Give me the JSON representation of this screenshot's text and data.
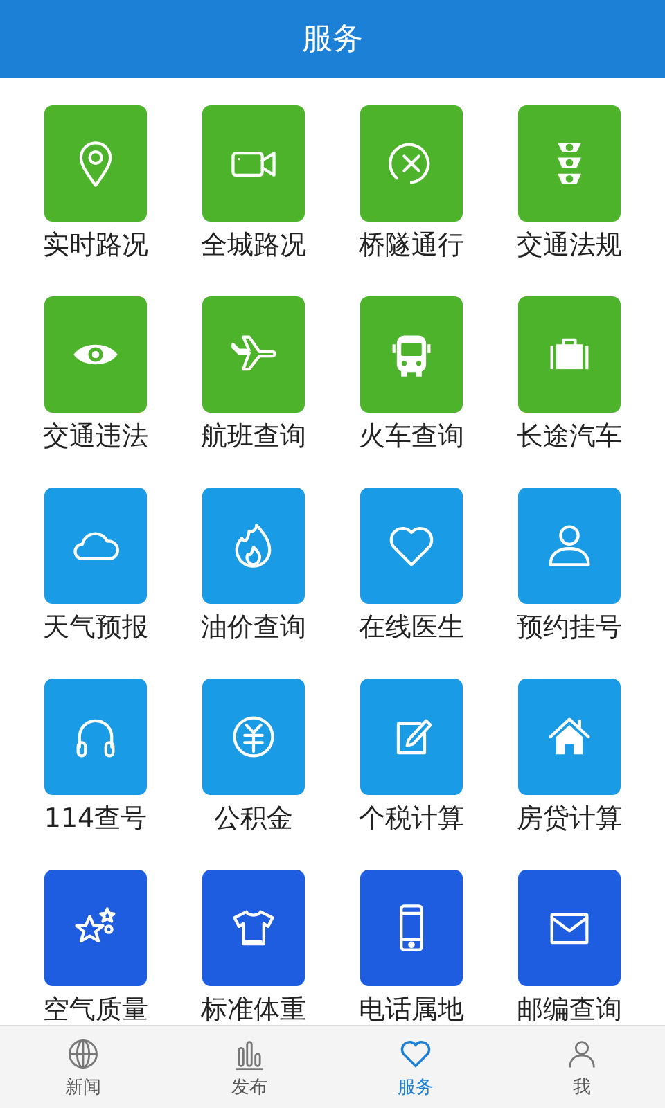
{
  "header": {
    "title": "服务"
  },
  "services": [
    {
      "label": "实时路况",
      "color": "#4cb32a"
    },
    {
      "label": "全城路况",
      "color": "#4cb32a"
    },
    {
      "label": "桥隧通行",
      "color": "#4cb32a"
    },
    {
      "label": "交通法规",
      "color": "#4cb32a"
    },
    {
      "label": "交通违法",
      "color": "#4cb32a"
    },
    {
      "label": "航班查询",
      "color": "#4cb32a"
    },
    {
      "label": "火车查询",
      "color": "#4cb32a"
    },
    {
      "label": "长途汽车",
      "color": "#4cb32a"
    },
    {
      "label": "天气预报",
      "color": "#1a9be6"
    },
    {
      "label": "油价查询",
      "color": "#1a9be6"
    },
    {
      "label": "在线医生",
      "color": "#1a9be6"
    },
    {
      "label": "预约挂号",
      "color": "#1a9be6"
    },
    {
      "label": "114查号",
      "color": "#1a9be6"
    },
    {
      "label": "公积金",
      "color": "#1a9be6"
    },
    {
      "label": "个税计算",
      "color": "#1a9be6"
    },
    {
      "label": "房贷计算",
      "color": "#1a9be6"
    },
    {
      "label": "空气质量",
      "color": "#1e5ce0"
    },
    {
      "label": "标准体重",
      "color": "#1e5ce0"
    },
    {
      "label": "电话属地",
      "color": "#1e5ce0"
    },
    {
      "label": "邮编查询",
      "color": "#1e5ce0"
    }
  ],
  "tab_bar": [
    {
      "label": "新闻",
      "selected": false
    },
    {
      "label": "发布",
      "selected": false
    },
    {
      "label": "服务",
      "selected": true
    },
    {
      "label": "我",
      "selected": false
    }
  ]
}
